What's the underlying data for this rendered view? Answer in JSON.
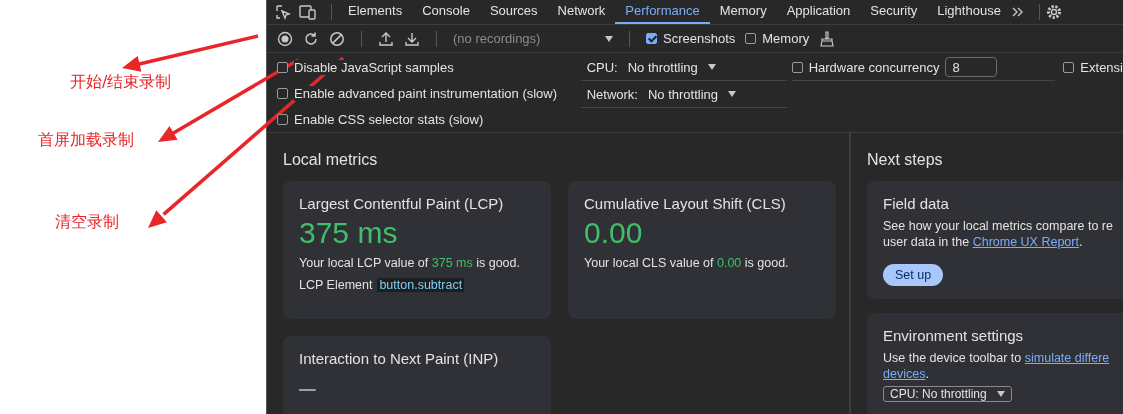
{
  "annotations": [
    {
      "label": "开始/结束录制"
    },
    {
      "label": "首屏加载录制"
    },
    {
      "label": "清空录制"
    }
  ],
  "tabs": [
    {
      "label": "Elements",
      "selected": false
    },
    {
      "label": "Console",
      "selected": false
    },
    {
      "label": "Sources",
      "selected": false
    },
    {
      "label": "Network",
      "selected": false
    },
    {
      "label": "Performance",
      "selected": true
    },
    {
      "label": "Memory",
      "selected": false
    },
    {
      "label": "Application",
      "selected": false
    },
    {
      "label": "Security",
      "selected": false
    },
    {
      "label": "Lighthouse",
      "selected": false
    }
  ],
  "toolbar": {
    "recordings": {
      "placeholder": "(no recordings)"
    },
    "screenshots": {
      "label": "Screenshots",
      "checked": true
    },
    "memory": {
      "label": "Memory",
      "checked": false
    }
  },
  "settings": {
    "options": [
      {
        "label": "Disable JavaScript samples",
        "checked": false
      },
      {
        "label": "Enable advanced paint instrumentation (slow)",
        "checked": false
      },
      {
        "label": "Enable CSS selector stats (slow)",
        "checked": false
      }
    ],
    "cpu": {
      "label": "CPU:",
      "value": "No throttling"
    },
    "network": {
      "label": "Network:",
      "value": "No throttling"
    },
    "hardware_concurrency": {
      "label": "Hardware concurrency",
      "checked": false,
      "value": "8"
    },
    "extension": {
      "label": "Extensi",
      "checked": false
    }
  },
  "local_metrics": {
    "title": "Local metrics",
    "cards": [
      {
        "title": "Largest Contentful Paint (LCP)",
        "value": "375 ms",
        "color": "#3fbf6a",
        "summary": "Your local LCP value of **375 ms** is good.",
        "element_label": "LCP Element",
        "element_value": "button.subtract"
      },
      {
        "title": "Cumulative Layout Shift (CLS)",
        "value": "0.00",
        "color": "#3fbf6a",
        "summary": "Your local CLS value of **0.00** is good."
      },
      {
        "title": "Interaction to Next Paint (INP)",
        "value": "–",
        "color": "#9aa0a6"
      }
    ]
  },
  "next_steps": {
    "title": "Next steps",
    "cards": [
      {
        "title": "Field data",
        "lines": [
          [
            {
              "text": "See how your local metrics compare to re"
            }
          ],
          [
            {
              "text": "user data in the "
            },
            {
              "text": "Chrome UX Report",
              "link": true
            },
            {
              "text": "."
            }
          ]
        ],
        "button": "Set up"
      },
      {
        "title": "Environment settings",
        "lines": [
          [
            {
              "text": "Use the device toolbar to "
            },
            {
              "text": "simulate differe",
              "link": true
            }
          ],
          [
            {
              "text": "devices",
              "link": true
            },
            {
              "text": "."
            }
          ]
        ],
        "select": "CPU: No throttling"
      }
    ]
  }
}
